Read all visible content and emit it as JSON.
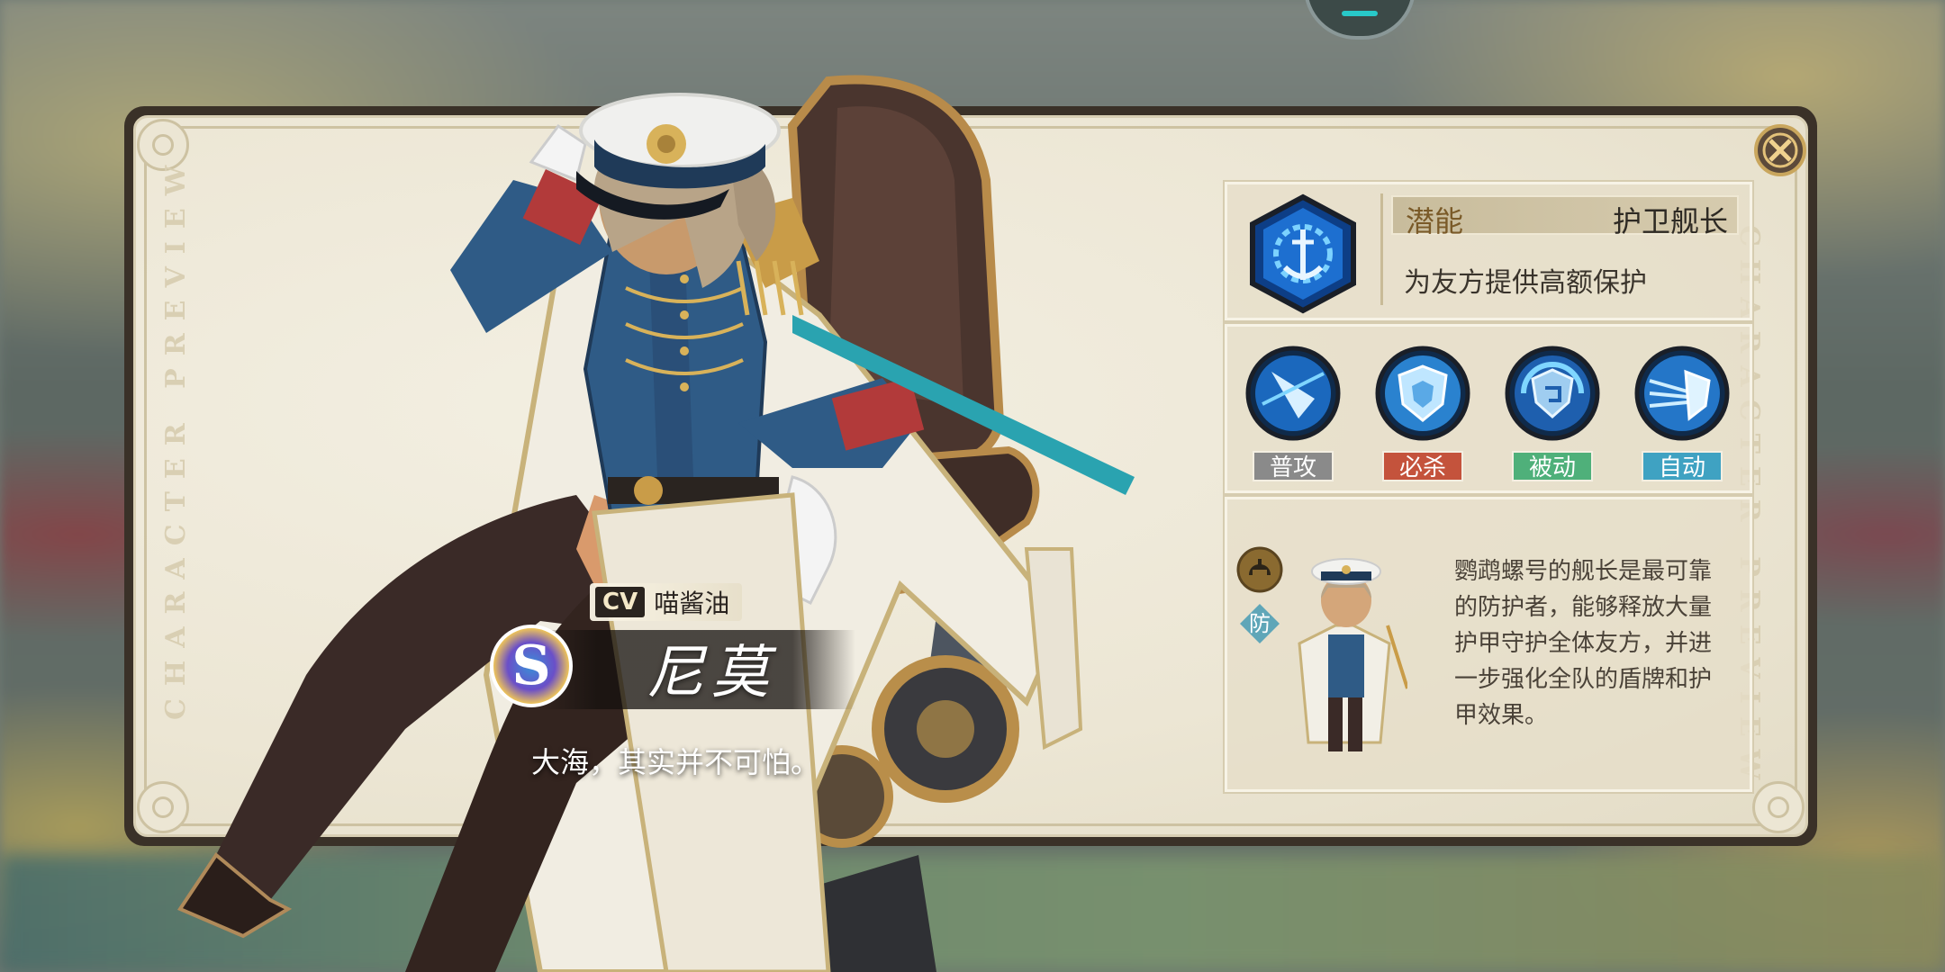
{
  "dialog": {
    "side_text": "CHARACTER PREVIEW"
  },
  "character": {
    "cv_badge": "CV",
    "cv_name": "喵酱油",
    "rank": "S",
    "name": "尼莫",
    "quote": "大海，其实并不可怕。"
  },
  "potential": {
    "label": "潜能",
    "name": "护卫舰长",
    "description": "为友方提供高额保护"
  },
  "skills": [
    {
      "label": "普攻",
      "color": "#8a8a8a",
      "icon": "sword-strike-icon"
    },
    {
      "label": "必杀",
      "color": "#c4533c",
      "icon": "shield-ultimate-icon"
    },
    {
      "label": "被动",
      "color": "#4fb07a",
      "icon": "shield-passive-icon"
    },
    {
      "label": "自动",
      "color": "#3fa2c2",
      "icon": "shield-auto-icon"
    }
  ],
  "profile": {
    "role": "防",
    "description": "鹦鹉螺号的舰长是最可靠的防护者，能够释放大量护甲守护全体友方，并进一步强化全队的盾牌和护甲效果。"
  }
}
